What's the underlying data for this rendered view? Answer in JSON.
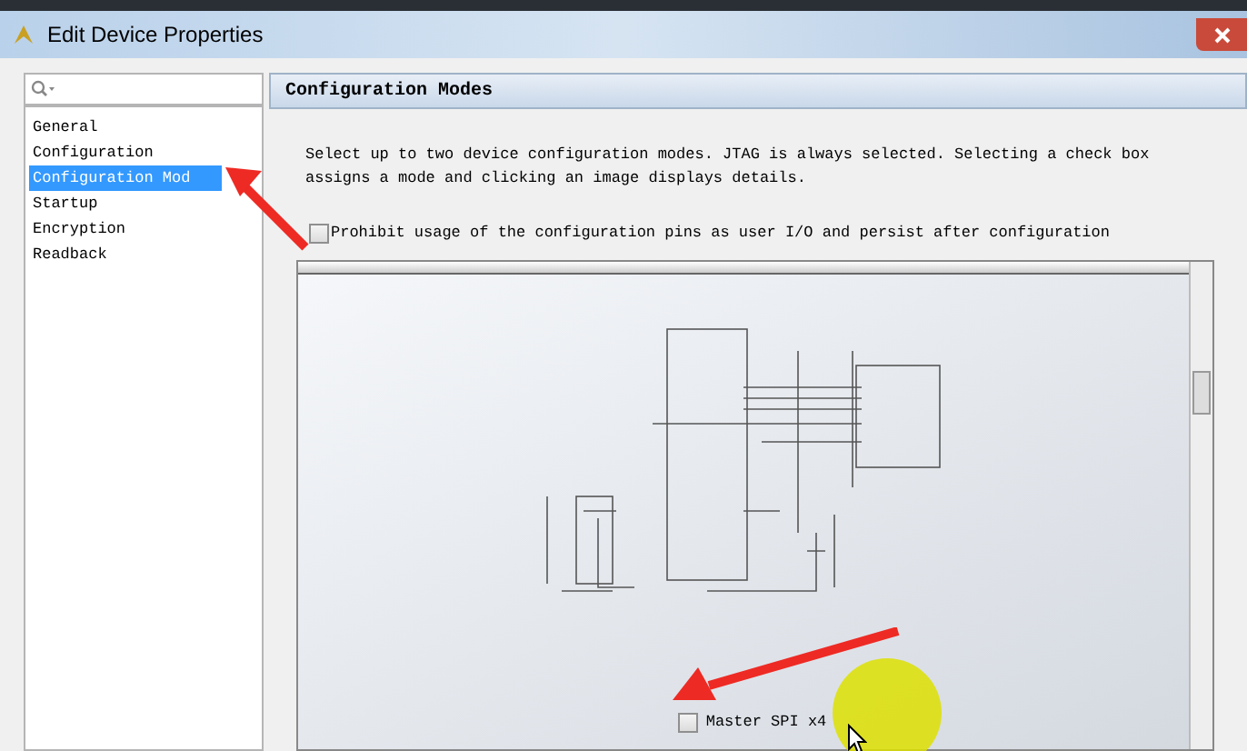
{
  "window": {
    "title": "Edit Device Properties"
  },
  "sidebar": {
    "items": [
      {
        "label": "General",
        "selected": false
      },
      {
        "label": "Configuration",
        "selected": false
      },
      {
        "label": "Configuration Mod",
        "selected": true
      },
      {
        "label": "Startup",
        "selected": false
      },
      {
        "label": "Encryption",
        "selected": false
      },
      {
        "label": "Readback",
        "selected": false
      }
    ]
  },
  "panel": {
    "title": "Configuration Modes",
    "description": "Select up to two device configuration modes. JTAG is always selected. Selecting a check box assigns a mode and clicking an image displays details.",
    "prohibit_option": {
      "label": "Prohibit usage of the configuration pins as user I/O and persist after configuration",
      "checked": false
    },
    "modes": [
      {
        "label": "Master SPI x4",
        "checked": false
      }
    ]
  }
}
